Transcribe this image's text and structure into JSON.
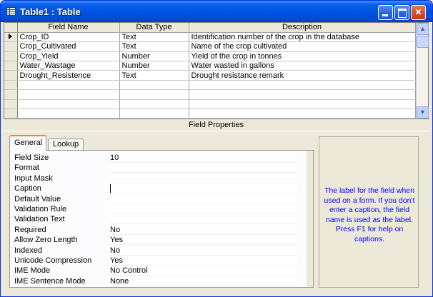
{
  "window": {
    "title": "Table1 : Table"
  },
  "grid": {
    "columns": [
      "Field Name",
      "Data Type",
      "Description"
    ],
    "rows": [
      {
        "field": "Crop_ID",
        "type": "Text",
        "desc": "Identification number of the crop in the database"
      },
      {
        "field": "Crop_Cultivated",
        "type": "Text",
        "desc": "Name of the crop cultivated"
      },
      {
        "field": "Crop_Yield",
        "type": "Number",
        "desc": "Yield of the crop in tonnes"
      },
      {
        "field": "Water_Wastage",
        "type": "Number",
        "desc": "Water wasted in gallons"
      },
      {
        "field": "Drought_Resistence",
        "type": "Text",
        "desc": "Drought resistance remark"
      }
    ]
  },
  "field_properties": {
    "header": "Field Properties",
    "tabs": [
      "General",
      "Lookup"
    ],
    "properties": [
      {
        "label": "Field Size",
        "value": "10"
      },
      {
        "label": "Format",
        "value": ""
      },
      {
        "label": "Input Mask",
        "value": ""
      },
      {
        "label": "Caption",
        "value": ""
      },
      {
        "label": "Default Value",
        "value": ""
      },
      {
        "label": "Validation Rule",
        "value": ""
      },
      {
        "label": "Validation Text",
        "value": ""
      },
      {
        "label": "Required",
        "value": "No"
      },
      {
        "label": "Allow Zero Length",
        "value": "Yes"
      },
      {
        "label": "Indexed",
        "value": "No"
      },
      {
        "label": "Unicode Compression",
        "value": "Yes"
      },
      {
        "label": "IME Mode",
        "value": "No Control"
      },
      {
        "label": "IME Sentence Mode",
        "value": "None"
      }
    ],
    "help": "The label for the field when used on a form.  If you don't enter a caption, the field name is used as the label.  Press F1 for help on captions."
  }
}
